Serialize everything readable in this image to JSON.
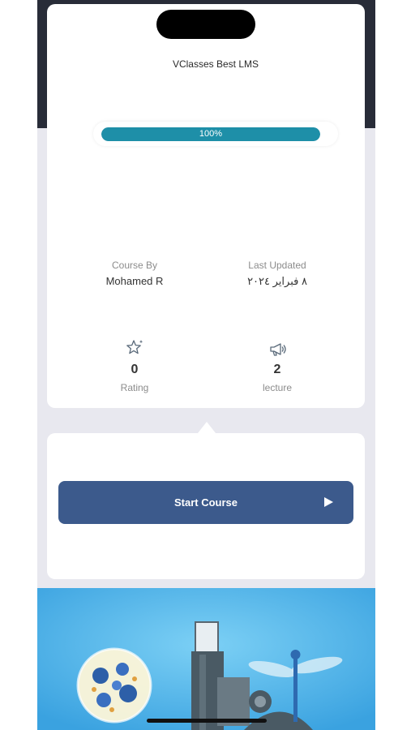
{
  "app": {
    "title": "VClasses Best LMS"
  },
  "progress": {
    "value": 1.0,
    "label": "100%"
  },
  "course": {
    "by_label": "Course By",
    "by_value": "Mohamed R",
    "updated_label": "Last Updated",
    "updated_value": "٨ فبراير ٢٠٢٤"
  },
  "stats": {
    "rating_value": "0",
    "rating_label": "Rating",
    "rating_icon": "star-icon",
    "lecture_value": "2",
    "lecture_label": "lecture",
    "lecture_icon": "megaphone-icon"
  },
  "actions": {
    "start_label": "Start Course",
    "start_icon": "play-icon"
  },
  "colors": {
    "header": "#282c38",
    "progress": "#1e8fa8",
    "button": "#3c5a8c",
    "illustration_sky": "#4fb3e8"
  }
}
